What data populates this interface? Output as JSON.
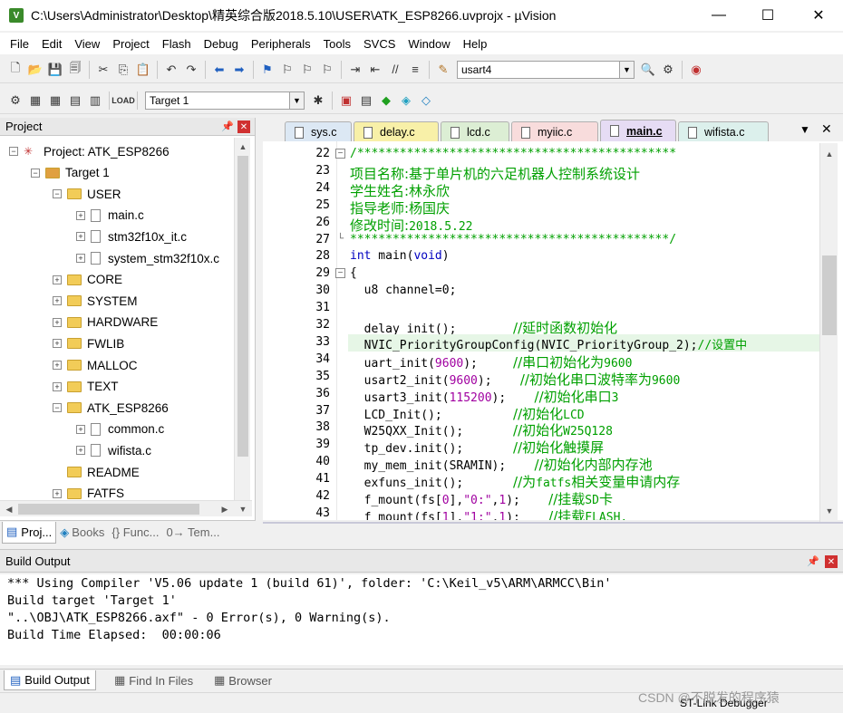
{
  "window": {
    "title": "C:\\Users\\Administrator\\Desktop\\精英综合版2018.5.10\\USER\\ATK_ESP8266.uvprojx - µVision"
  },
  "menu": [
    "File",
    "Edit",
    "View",
    "Project",
    "Flash",
    "Debug",
    "Peripherals",
    "Tools",
    "SVCS",
    "Window",
    "Help"
  ],
  "toolbar": {
    "find_value": "usart4",
    "target_value": "Target 1"
  },
  "project_panel": {
    "title": "Project",
    "tree": [
      {
        "label": "Project: ATK_ESP8266",
        "level": 0,
        "kind": "project",
        "exp": "−"
      },
      {
        "label": "Target 1",
        "level": 1,
        "kind": "target",
        "exp": "−"
      },
      {
        "label": "USER",
        "level": 2,
        "kind": "folder",
        "exp": "−"
      },
      {
        "label": "main.c",
        "level": 3,
        "kind": "file",
        "exp": "+"
      },
      {
        "label": "stm32f10x_it.c",
        "level": 3,
        "kind": "file",
        "exp": "+"
      },
      {
        "label": "system_stm32f10x.c",
        "level": 3,
        "kind": "file",
        "exp": "+"
      },
      {
        "label": "CORE",
        "level": 2,
        "kind": "folder",
        "exp": "+"
      },
      {
        "label": "SYSTEM",
        "level": 2,
        "kind": "folder",
        "exp": "+"
      },
      {
        "label": "HARDWARE",
        "level": 2,
        "kind": "folder",
        "exp": "+"
      },
      {
        "label": "FWLIB",
        "level": 2,
        "kind": "folder",
        "exp": "+"
      },
      {
        "label": "MALLOC",
        "level": 2,
        "kind": "folder",
        "exp": "+"
      },
      {
        "label": "TEXT",
        "level": 2,
        "kind": "folder",
        "exp": "+"
      },
      {
        "label": "ATK_ESP8266",
        "level": 2,
        "kind": "folder",
        "exp": "−"
      },
      {
        "label": "common.c",
        "level": 3,
        "kind": "file",
        "exp": "+"
      },
      {
        "label": "wifista.c",
        "level": 3,
        "kind": "file",
        "exp": "+"
      },
      {
        "label": "README",
        "level": 2,
        "kind": "folder",
        "exp": ""
      },
      {
        "label": "FATFS",
        "level": 2,
        "kind": "folder",
        "exp": "+"
      }
    ],
    "bottom_tabs": [
      "Proj...",
      "Books",
      "{} Func...",
      "0→ Tem..."
    ]
  },
  "editor": {
    "tabs": [
      {
        "label": "sys.c",
        "color": "#dce8f4",
        "active": false
      },
      {
        "label": "delay.c",
        "color": "#f8f0a8",
        "active": false
      },
      {
        "label": "lcd.c",
        "color": "#dceed4",
        "active": false
      },
      {
        "label": "myiic.c",
        "color": "#f8dcdc",
        "active": false
      },
      {
        "label": "main.c",
        "color": "#e6dcf4",
        "active": true
      },
      {
        "label": "wifista.c",
        "color": "#dcf0ec",
        "active": false
      }
    ],
    "lines": [
      {
        "n": "22",
        "fold": "−",
        "hl": false,
        "segs": [
          [
            "c",
            "/*********************************************"
          ]
        ]
      },
      {
        "n": "23",
        "fold": "",
        "hl": false,
        "segs": [
          [
            "cj",
            "项目名称:基于单片机的六足机器人控制系统设计"
          ]
        ]
      },
      {
        "n": "24",
        "fold": "",
        "hl": false,
        "segs": [
          [
            "cj",
            "学生姓名:林永欣"
          ]
        ]
      },
      {
        "n": "25",
        "fold": "",
        "hl": false,
        "segs": [
          [
            "cj",
            "指导老师:杨国庆"
          ]
        ]
      },
      {
        "n": "26",
        "fold": "",
        "hl": false,
        "segs": [
          [
            "cj",
            "修改时间:"
          ],
          [
            "c",
            "2018.5.22"
          ]
        ]
      },
      {
        "n": "27",
        "fold": "└",
        "hl": false,
        "segs": [
          [
            "c",
            "*********************************************/"
          ]
        ]
      },
      {
        "n": "28",
        "fold": "",
        "hl": false,
        "segs": [
          [
            "k",
            "int"
          ],
          [
            "t",
            " main("
          ],
          [
            "k",
            "void"
          ],
          [
            "t",
            ")"
          ]
        ]
      },
      {
        "n": "29",
        "fold": "−",
        "hl": false,
        "segs": [
          [
            "t",
            "{"
          ]
        ]
      },
      {
        "n": "30",
        "fold": "",
        "hl": false,
        "segs": [
          [
            "t",
            "  u8 channel=0;"
          ]
        ]
      },
      {
        "n": "31",
        "fold": "",
        "hl": false,
        "segs": [
          [
            "t",
            ""
          ]
        ]
      },
      {
        "n": "32",
        "fold": "",
        "hl": false,
        "segs": [
          [
            "t",
            "  delay_init();        "
          ],
          [
            "cj",
            "//延时函数初始化"
          ]
        ]
      },
      {
        "n": "33",
        "fold": "",
        "hl": true,
        "segs": [
          [
            "t",
            "  NVIC_PriorityGroupConfig(NVIC_PriorityGroup_2);"
          ],
          [
            "c",
            "//设置中"
          ]
        ]
      },
      {
        "n": "34",
        "fold": "",
        "hl": false,
        "segs": [
          [
            "t",
            "  uart_init("
          ],
          [
            "n",
            "9600"
          ],
          [
            "t",
            ");     "
          ],
          [
            "cj",
            "//串口初始化为"
          ],
          [
            "c",
            "9600"
          ]
        ]
      },
      {
        "n": "35",
        "fold": "",
        "hl": false,
        "segs": [
          [
            "t",
            "  usart2_init("
          ],
          [
            "n",
            "9600"
          ],
          [
            "t",
            ");    "
          ],
          [
            "cj",
            "//初始化串口波特率为"
          ],
          [
            "c",
            "9600"
          ]
        ]
      },
      {
        "n": "36",
        "fold": "",
        "hl": false,
        "segs": [
          [
            "t",
            "  usart3_init("
          ],
          [
            "n",
            "115200"
          ],
          [
            "t",
            ");    "
          ],
          [
            "cj",
            "//初始化串口"
          ],
          [
            "c",
            "3"
          ]
        ]
      },
      {
        "n": "37",
        "fold": "",
        "hl": false,
        "segs": [
          [
            "t",
            "  LCD_Init();          "
          ],
          [
            "cj",
            "//初始化"
          ],
          [
            "c",
            "LCD"
          ]
        ]
      },
      {
        "n": "38",
        "fold": "",
        "hl": false,
        "segs": [
          [
            "t",
            "  W25QXX_Init();       "
          ],
          [
            "cj",
            "//初始化"
          ],
          [
            "c",
            "W25Q128"
          ]
        ]
      },
      {
        "n": "39",
        "fold": "",
        "hl": false,
        "segs": [
          [
            "t",
            "  tp_dev.init();       "
          ],
          [
            "cj",
            "//初始化触摸屏"
          ]
        ]
      },
      {
        "n": "40",
        "fold": "",
        "hl": false,
        "segs": [
          [
            "t",
            "  my_mem_init(SRAMIN);    "
          ],
          [
            "cj",
            "//初始化内部内存池"
          ]
        ]
      },
      {
        "n": "41",
        "fold": "",
        "hl": false,
        "segs": [
          [
            "t",
            "  exfuns_init();       "
          ],
          [
            "cj",
            "//为"
          ],
          [
            "c",
            "fatfs"
          ],
          [
            "cj",
            "相关变量申请内存"
          ]
        ]
      },
      {
        "n": "42",
        "fold": "",
        "hl": false,
        "segs": [
          [
            "t",
            "  f_mount(fs["
          ],
          [
            "n",
            "0"
          ],
          [
            "t",
            "],"
          ],
          [
            "s",
            "\"0:\""
          ],
          [
            "t",
            ","
          ],
          [
            "n",
            "1"
          ],
          [
            "t",
            ");    "
          ],
          [
            "cj",
            "//挂载"
          ],
          [
            "c",
            "SD"
          ],
          [
            "cj",
            "卡"
          ]
        ]
      },
      {
        "n": "43",
        "fold": "",
        "hl": false,
        "segs": [
          [
            "t",
            "  f_mount(fs["
          ],
          [
            "n",
            "1"
          ],
          [
            "t",
            "],"
          ],
          [
            "s",
            "\"1:\""
          ],
          [
            "t",
            ","
          ],
          [
            "n",
            "1"
          ],
          [
            "t",
            ");    "
          ],
          [
            "cj",
            "//挂载"
          ],
          [
            "c",
            "FLASH."
          ]
        ]
      }
    ]
  },
  "build_output": {
    "title": "Build Output",
    "lines": [
      "*** Using Compiler 'V5.06 update 1 (build 61)', folder: 'C:\\Keil_v5\\ARM\\ARMCC\\Bin'",
      "Build target 'Target 1'",
      "\"..\\OBJ\\ATK_ESP8266.axf\" - 0 Error(s), 0 Warning(s).",
      "Build Time Elapsed:  00:00:06"
    ],
    "tabs": [
      "Build Output",
      "Find In Files",
      "Browser"
    ]
  },
  "status_bar": {
    "debugger": "ST-Link Debugger"
  },
  "watermark": "CSDN @不脱发的程序猿"
}
